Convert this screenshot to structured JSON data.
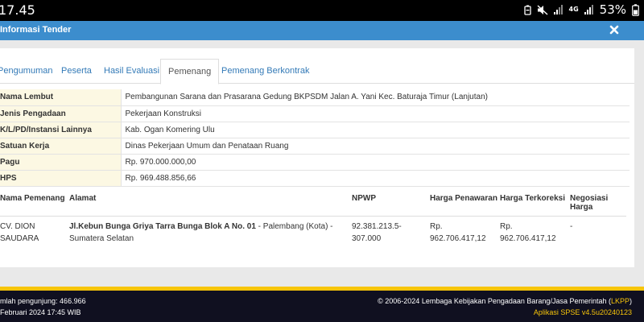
{
  "status_bar": {
    "time": "17.45",
    "battery": "53%",
    "network": "4G"
  },
  "modal": {
    "title": "Informasi Tender"
  },
  "tabs": [
    {
      "label": "Pengumuman"
    },
    {
      "label": "Peserta"
    },
    {
      "label": "Hasil Evaluasi"
    },
    {
      "label": "Pemenang"
    },
    {
      "label": "Pemenang Berkontrak"
    }
  ],
  "info": [
    {
      "label": "Nama Lembut",
      "value": "Pembangunan Sarana dan Prasarana Gedung BKPSDM Jalan A. Yani Kec. Baturaja Timur (Lanjutan)"
    },
    {
      "label": "Jenis Pengadaan",
      "value": "Pekerjaan Konstruksi"
    },
    {
      "label": "K/L/PD/Instansi Lainnya",
      "value": "Kab. Ogan Komering Ulu"
    },
    {
      "label": "Satuan Kerja",
      "value": "Dinas Pekerjaan Umum dan Penataan Ruang"
    },
    {
      "label": "Pagu",
      "value": "Rp. 970.000.000,00"
    },
    {
      "label": "HPS",
      "value": "Rp. 969.488.856,66"
    }
  ],
  "winners": {
    "headers": [
      "Nama Pemenang",
      "Alamat",
      "NPWP",
      "Harga Penawaran",
      "Harga Terkoreksi",
      "Negosiasi Harga"
    ],
    "rows": [
      {
        "name": "CV. DION SAUDARA",
        "address_bold": "Jl.Kebun Bunga Griya Tarra Bunga Blok A No. 01",
        "address_rest": " - Palembang (Kota) - Sumatera Selatan",
        "npwp": "92.381.213.5-307.000",
        "harga_penawaran": "Rp. 962.706.417,12",
        "harga_terkoreksi": "Rp. 962.706.417,12",
        "negosiasi": "-"
      }
    ]
  },
  "footer": {
    "visitors": "mlah pengunjung: 466.966",
    "date": "Februari 2024 17:45 WIB",
    "copyright": "© 2006-2024 Lembaga Kebijakan Pengadaan Barang/Jasa Pemerintah (",
    "lkpp": "LKPP",
    "copyright_end": ")",
    "app_version": "Aplikasi SPSE v4.5u20240123"
  },
  "colors": {
    "header": "#3c8dcd",
    "label_bg": "#fcf8e3",
    "accent": "#f7c50a",
    "link": "#337ab7",
    "footer_bg": "#101020"
  }
}
